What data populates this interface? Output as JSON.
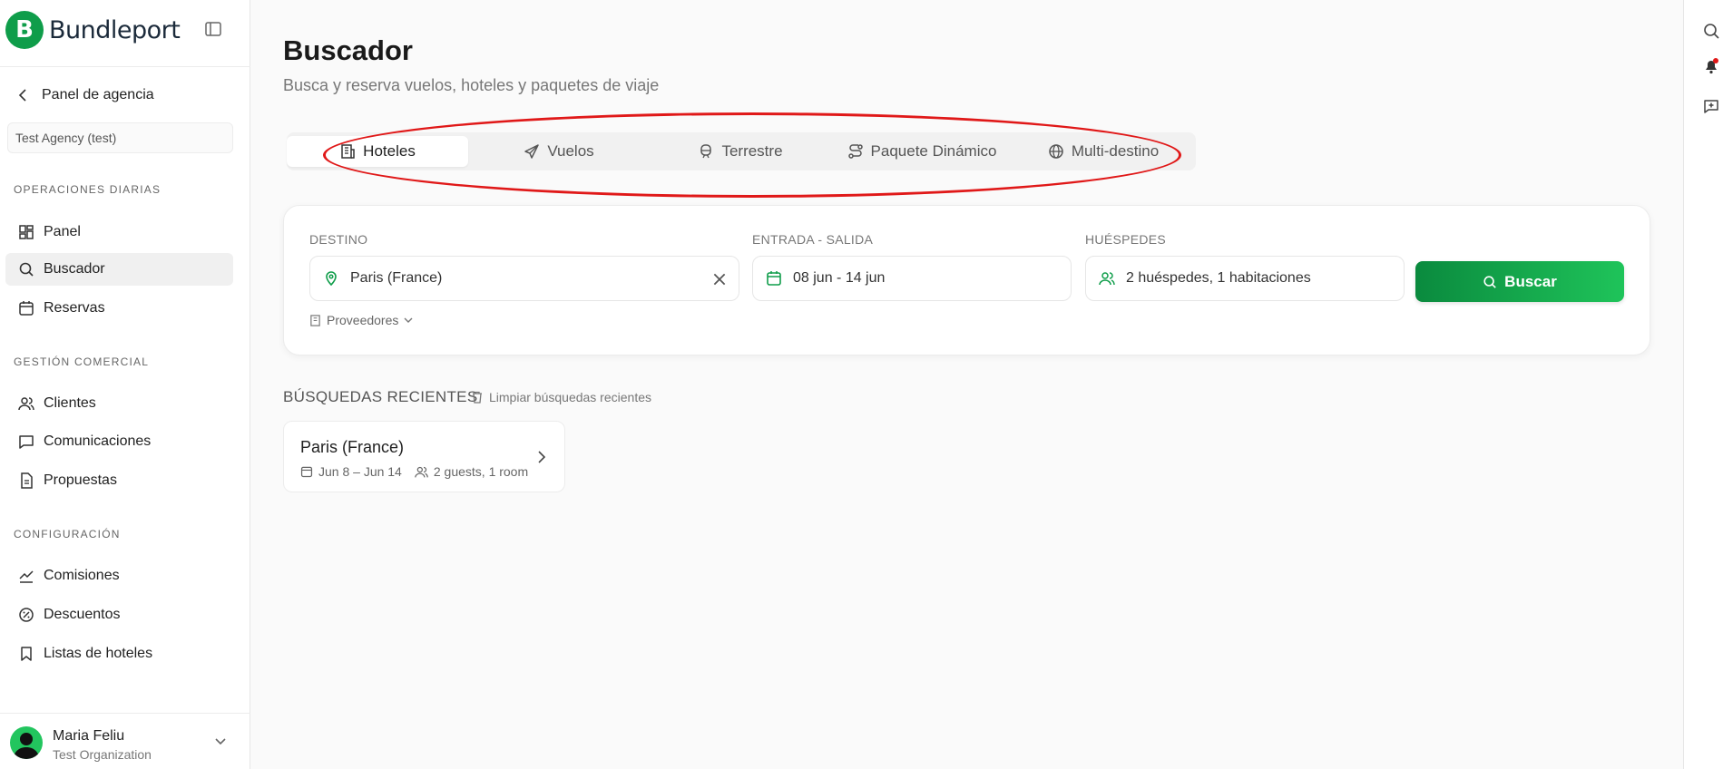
{
  "brand": {
    "name": "Bundleport",
    "logo_letter": "B",
    "color": "#0f9d4a"
  },
  "sidebar": {
    "back_label": "Panel de agencia",
    "agency": "Test Agency (test)",
    "sections": [
      {
        "label": "OPERACIONES DIARIAS",
        "items": [
          {
            "label": "Panel",
            "icon": "dashboard-icon"
          },
          {
            "label": "Buscador",
            "icon": "search-icon",
            "active": true
          },
          {
            "label": "Reservas",
            "icon": "calendar-icon"
          }
        ]
      },
      {
        "label": "GESTIÓN COMERCIAL",
        "items": [
          {
            "label": "Clientes",
            "icon": "users-icon"
          },
          {
            "label": "Comunicaciones",
            "icon": "message-icon"
          },
          {
            "label": "Propuestas",
            "icon": "document-icon"
          }
        ]
      },
      {
        "label": "CONFIGURACIÓN",
        "items": [
          {
            "label": "Comisiones",
            "icon": "commission-icon"
          },
          {
            "label": "Descuentos",
            "icon": "discount-icon"
          },
          {
            "label": "Listas de hoteles",
            "icon": "bookmark-icon"
          }
        ]
      }
    ],
    "user": {
      "name": "Maria Feliu",
      "org": "Test Organization"
    }
  },
  "main": {
    "title": "Buscador",
    "subtitle": "Busca y reserva vuelos, hoteles y paquetes de viaje",
    "tabs": [
      {
        "label": "Hoteles",
        "icon": "hotel-icon",
        "active": true
      },
      {
        "label": "Vuelos",
        "icon": "plane-icon"
      },
      {
        "label": "Terrestre",
        "icon": "train-icon"
      },
      {
        "label": "Paquete Dinámico",
        "icon": "route-icon"
      },
      {
        "label": "Multi-destino",
        "icon": "globe-icon"
      }
    ],
    "search": {
      "destination_label": "DESTINO",
      "destination_value": "Paris (France)",
      "dates_label": "ENTRADA - SALIDA",
      "dates_value": "08 jun - 14 jun",
      "guests_label": "HUÉSPEDES",
      "guests_value": "2 huéspedes, 1 habitaciones",
      "button_label": "Buscar",
      "providers_label": "Proveedores"
    },
    "recent": {
      "title": "BÚSQUEDAS RECIENTES",
      "clear_label": "Limpiar búsquedas recientes",
      "items": [
        {
          "name": "Paris (France)",
          "dates": "Jun 8 – Jun 14",
          "guests": "2 guests, 1 room"
        }
      ]
    }
  },
  "colors": {
    "accent": "#0f9d4a",
    "annotation": "#e01818"
  }
}
